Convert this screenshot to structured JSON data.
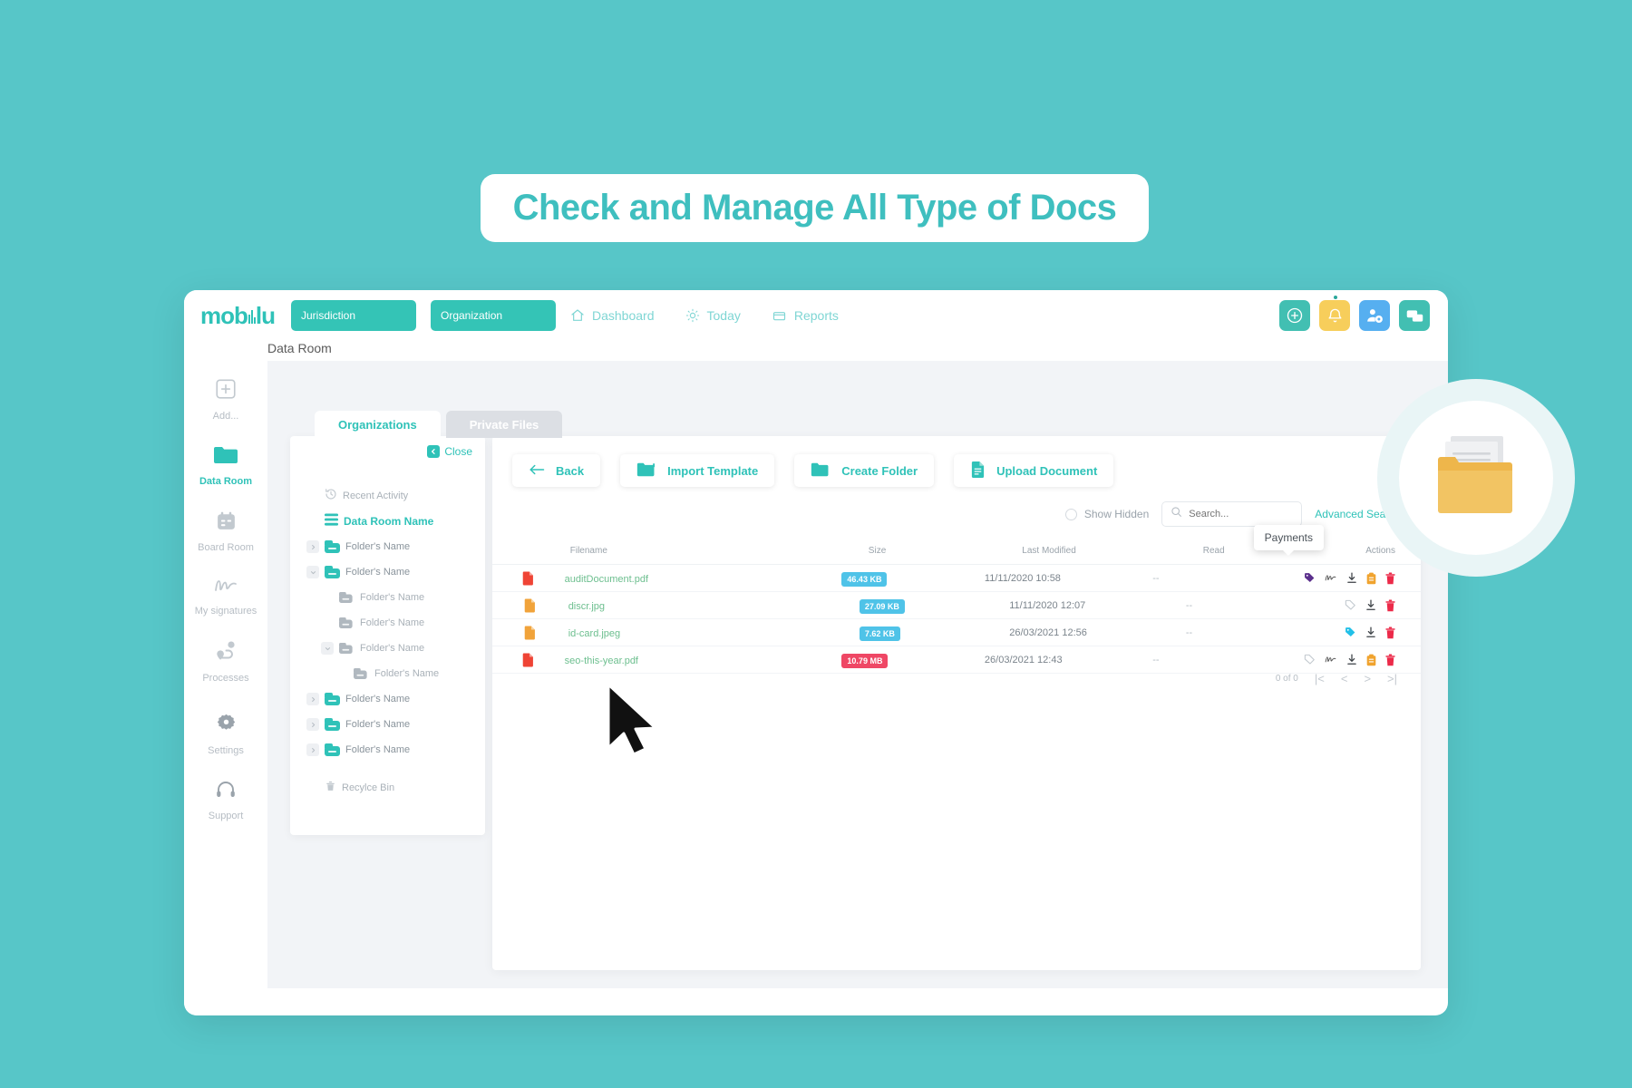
{
  "banner": {
    "title": "Check and Manage All Type of Docs"
  },
  "brand": {
    "name": "mobilu",
    "accent": "#2fc2b8",
    "page_bg": "#57c6c8"
  },
  "topbar": {
    "jurisdiction_label": "Jurisdiction",
    "organization_label": "Organization",
    "nav": [
      {
        "label": "Dashboard",
        "icon": "home-icon"
      },
      {
        "label": "Today",
        "icon": "sun-icon"
      },
      {
        "label": "Reports",
        "icon": "report-icon"
      }
    ],
    "actions": [
      {
        "name": "add-button",
        "icon": "plus-circle-icon",
        "color": "#42bfb2"
      },
      {
        "name": "notifications-button",
        "icon": "bell-icon",
        "color": "#f7ce5b"
      },
      {
        "name": "user-settings-button",
        "icon": "user-gear-icon",
        "color": "#56aff0"
      },
      {
        "name": "messages-button",
        "icon": "chat-icon",
        "color": "#42bfb2"
      }
    ]
  },
  "breadcrumb": "Data Room",
  "sidebar": {
    "items": [
      {
        "label": "Add...",
        "icon": "plus-square-icon",
        "active": false
      },
      {
        "label": "Data Room",
        "icon": "folder-icon",
        "active": true
      },
      {
        "label": "Board Room",
        "icon": "calendar-icon",
        "active": false
      },
      {
        "label": "My signatures",
        "icon": "signature-icon",
        "active": false
      },
      {
        "label": "Processes",
        "icon": "process-icon",
        "active": false
      },
      {
        "label": "Settings",
        "icon": "gear-icon",
        "active": false
      },
      {
        "label": "Support",
        "icon": "headset-icon",
        "active": false
      }
    ]
  },
  "tabs": [
    {
      "label": "Organizations",
      "active": true
    },
    {
      "label": "Private Files",
      "active": false
    }
  ],
  "tree_panel": {
    "close_label": "Close",
    "rows": [
      {
        "label": "Recent Activity",
        "type": "history",
        "depth": 0,
        "caret": "none"
      },
      {
        "label": "Data Room Name",
        "type": "dataroom",
        "depth": 0,
        "caret": "none"
      },
      {
        "label": "Folder's Name",
        "type": "folder-teal",
        "depth": 0,
        "caret": "right"
      },
      {
        "label": "Folder's Name",
        "type": "folder-teal",
        "depth": 0,
        "caret": "down"
      },
      {
        "label": "Folder's Name",
        "type": "folder-grey",
        "depth": 1,
        "caret": "none"
      },
      {
        "label": "Folder's Name",
        "type": "folder-grey",
        "depth": 1,
        "caret": "none"
      },
      {
        "label": "Folder's Name",
        "type": "folder-grey",
        "depth": 1,
        "caret": "down"
      },
      {
        "label": "Folder's Name",
        "type": "folder-grey",
        "depth": 2,
        "caret": "none"
      },
      {
        "label": "Folder's Name",
        "type": "folder-teal",
        "depth": 0,
        "caret": "right"
      },
      {
        "label": "Folder's Name",
        "type": "folder-teal",
        "depth": 0,
        "caret": "right"
      },
      {
        "label": "Folder's Name",
        "type": "folder-teal",
        "depth": 0,
        "caret": "right"
      },
      {
        "label": "Recylce Bin",
        "type": "trash",
        "depth": 0,
        "caret": "none"
      }
    ]
  },
  "toolbar": {
    "back_label": "Back",
    "import_template_label": "Import Template",
    "create_folder_label": "Create Folder",
    "upload_document_label": "Upload Document"
  },
  "search": {
    "show_hidden_label": "Show Hidden",
    "placeholder": "Search...",
    "value": "",
    "advanced_label": "Advanced Search"
  },
  "tooltip": {
    "text": "Payments"
  },
  "table": {
    "headers": [
      "Filename",
      "Size",
      "Last Modified",
      "Read",
      "Actions"
    ],
    "rows": [
      {
        "filetype": "pdf",
        "filename": "auditDocument.pdf",
        "size": "46.43 KB",
        "size_color": "blue",
        "modified": "11/11/2020 10:58",
        "read": "--",
        "actions": [
          "tag-purple-icon",
          "signature-icon",
          "download-icon",
          "payments-icon",
          "delete-icon"
        ]
      },
      {
        "filetype": "img",
        "filename": "discr.jpg",
        "size": "27.09 KB",
        "size_color": "blue",
        "modified": "11/11/2020 12:07",
        "read": "--",
        "actions": [
          "tag-outline-icon",
          "download-icon",
          "delete-icon"
        ]
      },
      {
        "filetype": "img",
        "filename": "id-card.jpeg",
        "size": "7.62 KB",
        "size_color": "blue",
        "modified": "26/03/2021 12:56",
        "read": "--",
        "actions": [
          "tag-cyan-icon",
          "download-icon",
          "delete-icon"
        ]
      },
      {
        "filetype": "pdf",
        "filename": "seo-this-year.pdf",
        "size": "10.79 MB",
        "size_color": "red",
        "modified": "26/03/2021 12:43",
        "read": "--",
        "actions": [
          "tag-outline-icon",
          "signature-icon",
          "download-icon",
          "payments-icon",
          "delete-icon"
        ]
      }
    ]
  },
  "pagination": {
    "count": "0 of 0",
    "first": "|<",
    "prev": "<",
    "next": ">",
    "last": ">|"
  }
}
